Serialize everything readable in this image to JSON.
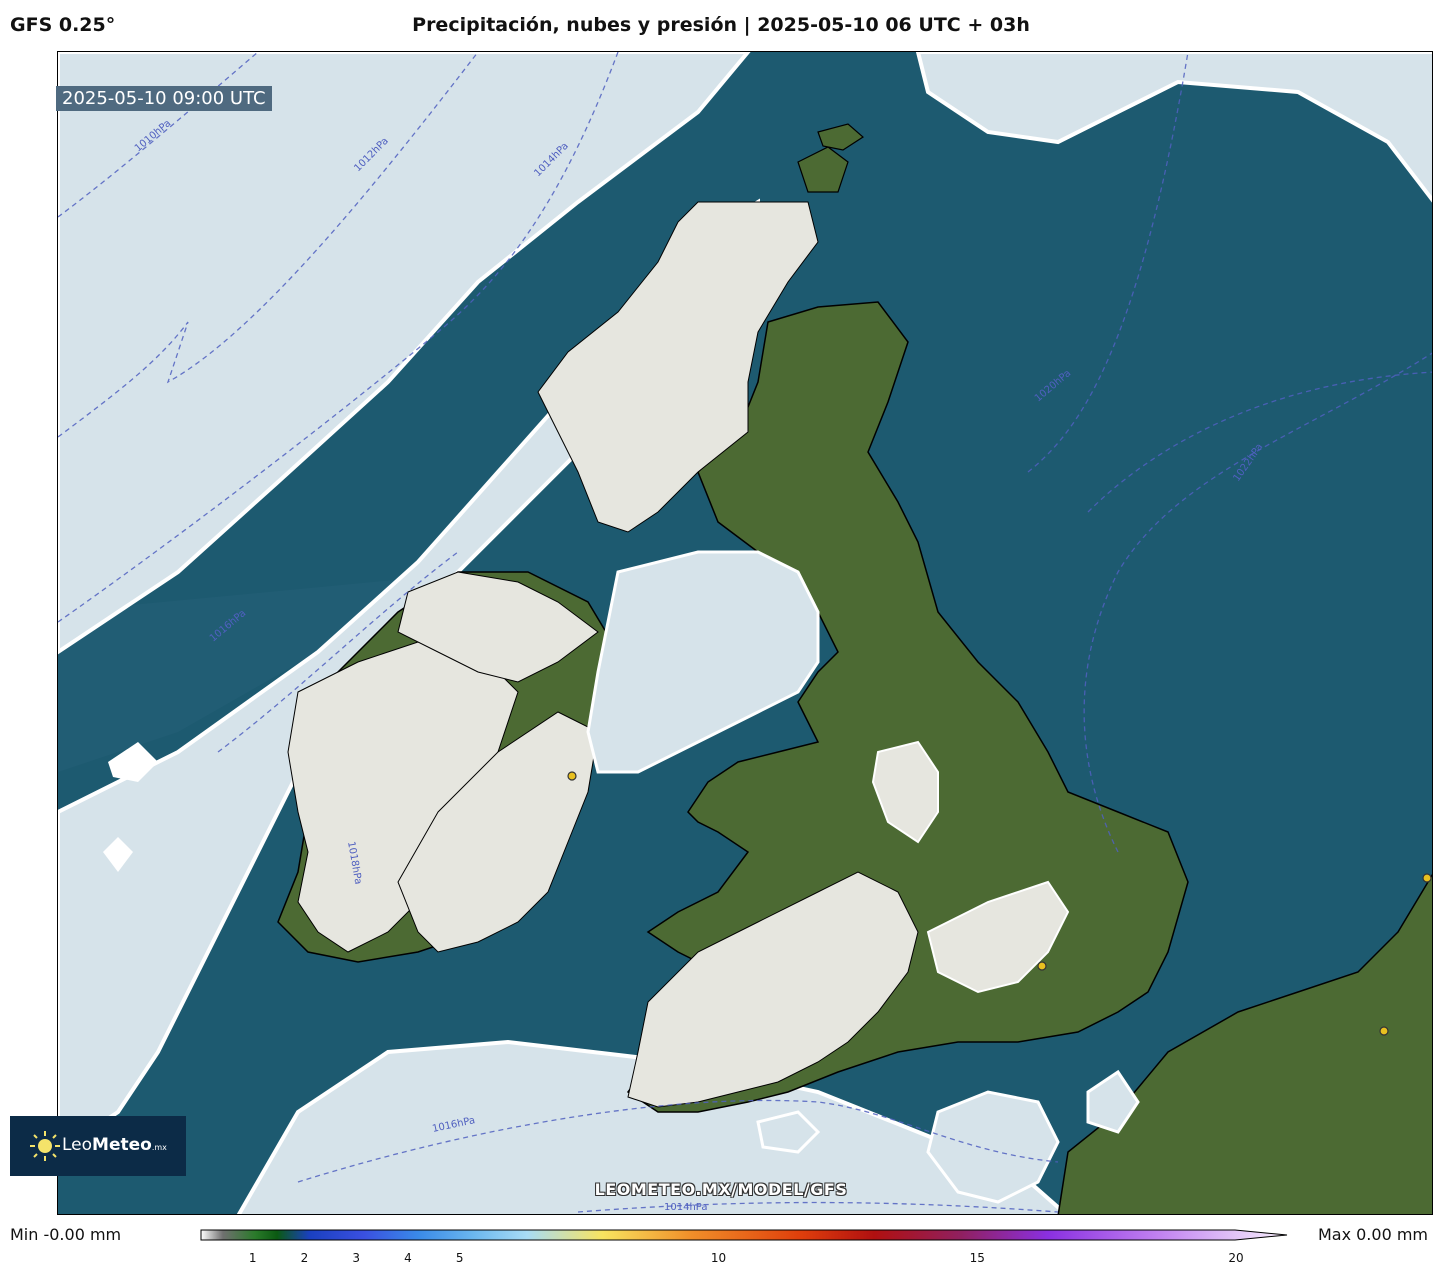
{
  "header": {
    "model": "GFS 0.25°",
    "title": "Precipitación, nubes y presión | 2025-05-10 06 UTC + 03h"
  },
  "map": {
    "valid_time": "2025-05-10 09:00 UTC",
    "watermark": "LEOMETEO.MX/MODEL/GFS",
    "isobar_labels": [
      "1010hPa",
      "1012hPa",
      "1014hPa",
      "1016hPa",
      "1018hPa",
      "1020hPa",
      "1022hPa",
      "1016hPa",
      "1014hPa"
    ],
    "colors": {
      "sea": "#1d5a70",
      "cloud": "#d6e3ea",
      "land_cloud": "#e6e6df",
      "land": "#4c6a33",
      "isobar": "#5060c0"
    }
  },
  "logo": {
    "brand_light": "Leo",
    "brand_bold": "Meteo",
    "suffix": ".mx"
  },
  "colorbar": {
    "min_label": "Min -0.00 mm",
    "max_label": "Max 0.00 mm",
    "ticks": [
      "1",
      "2",
      "3",
      "4",
      "5",
      "10",
      "15",
      "20"
    ],
    "tick_values": [
      1,
      2,
      3,
      4,
      5,
      10,
      15,
      20
    ],
    "range": [
      0,
      20
    ]
  }
}
